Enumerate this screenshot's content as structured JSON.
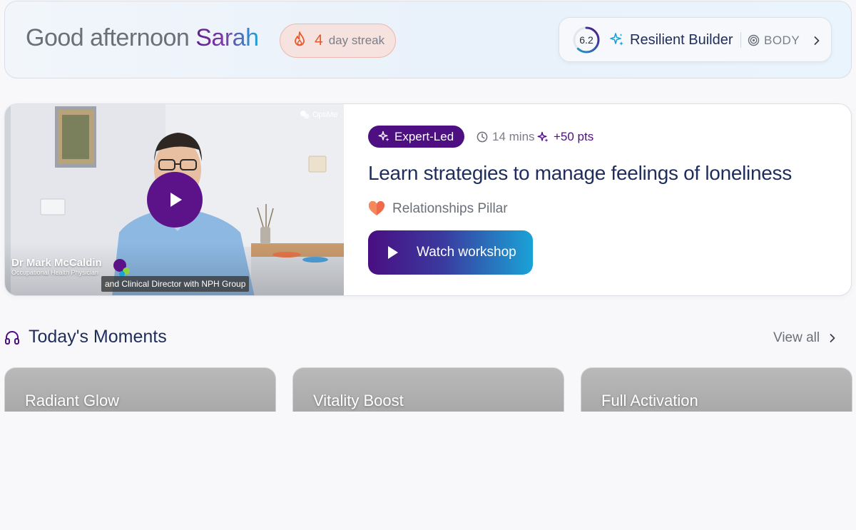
{
  "header": {
    "greeting": "Good afternoon",
    "user_name": "Sarah",
    "streak": {
      "count": "4",
      "label": "day streak"
    },
    "profile": {
      "score": "6.2",
      "score_fraction": 0.62,
      "tier": "Resilient Builder",
      "pillar": "BODY"
    }
  },
  "featured": {
    "video": {
      "brand": "OptiMe",
      "presenter_name": "Dr Mark McCaldin",
      "presenter_role": "Occupational Health Physician",
      "caption": "and Clinical Director with NPH Group"
    },
    "badge": "Expert-Led",
    "duration": "14 mins",
    "points": "+50 pts",
    "title": "Learn strategies to manage feelings of loneliness",
    "pillar": "Relationships Pillar",
    "cta": "Watch workshop"
  },
  "moments": {
    "title": "Today's Moments",
    "view_all": "View all",
    "items": [
      {
        "label": "Radiant Glow"
      },
      {
        "label": "Vitality Boost"
      },
      {
        "label": "Full Activation"
      }
    ]
  },
  "colors": {
    "brand_purple": "#4e0f83",
    "brand_blue": "#1aa3d6",
    "streak_orange": "#e65a2b",
    "heart": "#ef6a4a",
    "navy_text": "#1f2d5a"
  }
}
